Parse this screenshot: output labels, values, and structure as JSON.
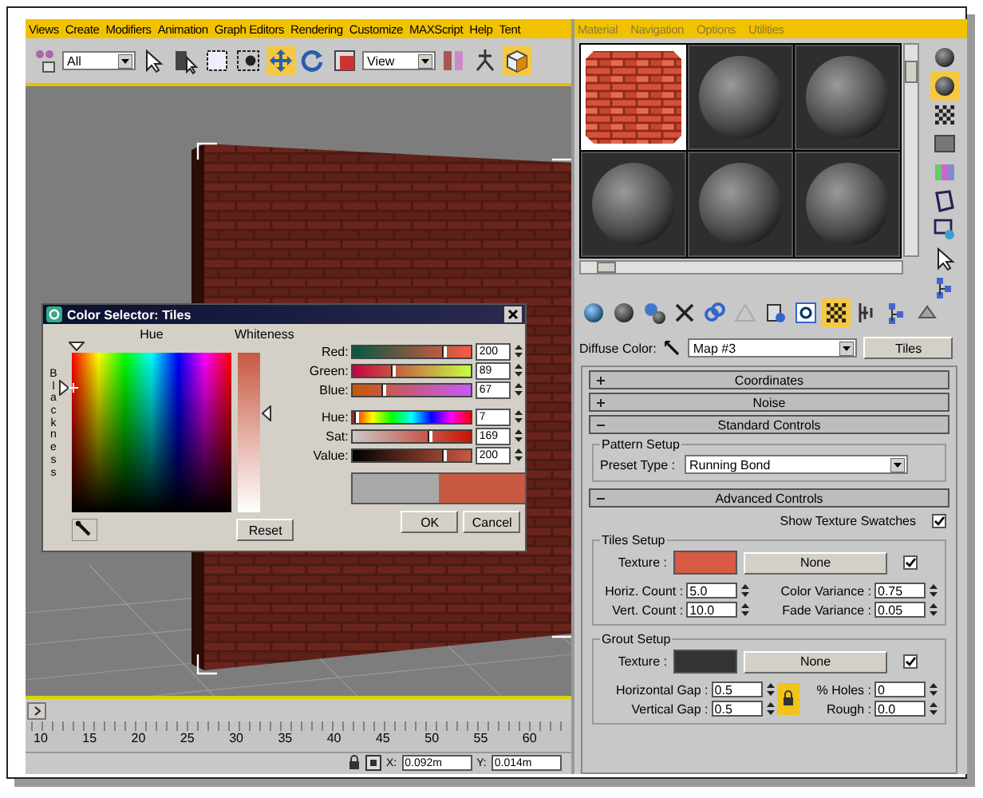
{
  "menu_bar": {
    "items": [
      "Views",
      "Create",
      "Modifiers",
      "Animation",
      "Graph Editors",
      "Rendering",
      "Customize",
      "MAXScript",
      "Help",
      "Tent"
    ]
  },
  "main_toolbar": {
    "selection_filter": "All",
    "reference_coordinate_system": "View"
  },
  "color_selector": {
    "title": "Color Selector: Tiles",
    "hue_label": "Hue",
    "whiteness_label": "Whiteness",
    "blackness_label": "Blackness",
    "channels": [
      {
        "kind": "red",
        "label": "Red:",
        "value": "200",
        "level": 0.78
      },
      {
        "kind": "green",
        "label": "Green:",
        "value": "89",
        "level": 0.35
      },
      {
        "kind": "blue",
        "label": "Blue:",
        "value": "67",
        "level": 0.26
      },
      {
        "kind": "hue",
        "label": "Hue:",
        "value": "7",
        "level": 0.03
      },
      {
        "kind": "sat",
        "label": "Sat:",
        "value": "169",
        "level": 0.66
      },
      {
        "kind": "value",
        "label": "Value:",
        "value": "200",
        "level": 0.78
      }
    ],
    "reset_button": "Reset",
    "ok_button": "OK",
    "cancel_button": "Cancel"
  },
  "timeline": {
    "ticks": [
      "10",
      "15",
      "20",
      "25",
      "30",
      "35",
      "40",
      "45",
      "50",
      "55",
      "60"
    ]
  },
  "status_bar": {
    "x_label": "X:",
    "x_value": "0.092m",
    "y_label": "Y:",
    "y_value": "0.014m"
  },
  "material_editor": {
    "menu": [
      "Material",
      "Navigation",
      "Options",
      "Utilities"
    ],
    "slots": [
      {
        "kind": "bricks",
        "selected": true
      },
      {
        "kind": "sphere",
        "selected": false
      },
      {
        "kind": "sphere",
        "selected": false
      },
      {
        "kind": "sphere",
        "selected": false
      },
      {
        "kind": "sphere",
        "selected": false
      },
      {
        "kind": "sphere",
        "selected": false
      }
    ],
    "diffuse_label": "Diffuse Color:",
    "map_name": "Map #3",
    "map_type": "Tiles",
    "rollouts": [
      {
        "kind": "plain",
        "title": "Coordinates",
        "expanded": false
      },
      {
        "kind": "plain",
        "title": "Noise",
        "expanded": false
      },
      {
        "kind": "standard",
        "title": "Standard Controls",
        "expanded": true,
        "pattern_setup": {
          "title": "Pattern Setup",
          "preset_label": "Preset Type :",
          "preset_value": "Running Bond"
        }
      },
      {
        "kind": "advanced",
        "title": "Advanced Controls",
        "expanded": true,
        "show_swatches": {
          "label": "Show Texture Swatches",
          "checked": true
        },
        "groups": [
          {
            "title": "Tiles Setup",
            "texture_label": "Texture :",
            "color": "#d65a44",
            "map_button": "None",
            "map_enabled": true,
            "fields": [
              {
                "label": "Horiz. Count :",
                "value": "5.0"
              },
              {
                "label": "Color Variance :",
                "value": "0.75"
              },
              {
                "label": "Vert. Count :",
                "value": "10.0"
              },
              {
                "label": "Fade Variance :",
                "value": "0.05"
              }
            ]
          },
          {
            "title": "Grout Setup",
            "texture_label": "Texture :",
            "color": "#333333",
            "map_button": "None",
            "map_enabled": true,
            "lock_on": true,
            "fields": [
              {
                "label": "Horizontal Gap :",
                "value": "0.5"
              },
              {
                "label": "% Holes :",
                "value": "0"
              },
              {
                "label": "Vertical Gap :",
                "value": "0.5"
              },
              {
                "label": "Rough :",
                "value": "0.0"
              }
            ]
          }
        ]
      }
    ]
  }
}
